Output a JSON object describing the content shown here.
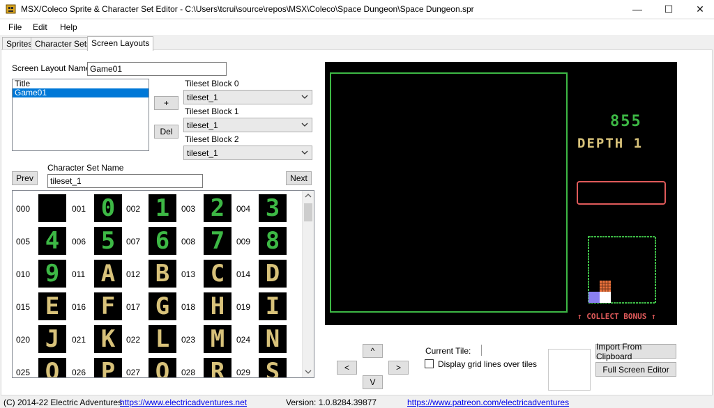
{
  "window": {
    "title": "MSX/Coleco Sprite & Character Set Editor - C:\\Users\\tcrui\\source\\repos\\MSX\\Coleco\\Space Dungeon\\Space Dungeon.spr",
    "minimize": "—",
    "maximize": "☐",
    "close": "✕"
  },
  "menu": {
    "file": "File",
    "edit": "Edit",
    "help": "Help"
  },
  "tabs": {
    "sprites": "Sprites",
    "character_sets": "Character Sets",
    "screen_layouts": "Screen Layouts"
  },
  "layout": {
    "name_label": "Screen Layout Name:",
    "name_value": "Game01",
    "layouts": [
      "Title",
      "Game01"
    ],
    "add_button": "+",
    "del_button": "Del",
    "tileset_blocks": [
      {
        "label": "Tileset Block 0",
        "value": "tileset_1"
      },
      {
        "label": "Tileset Block 1",
        "value": "tileset_1"
      },
      {
        "label": "Tileset Block 2",
        "value": "tileset_1"
      }
    ]
  },
  "charset": {
    "name_label": "Character Set Name",
    "name_value": "tileset_1",
    "prev_button": "Prev",
    "next_button": "Next",
    "tile_numbers": [
      "000",
      "001",
      "002",
      "003",
      "004",
      "005",
      "006",
      "007",
      "008",
      "009",
      "010",
      "011",
      "012",
      "013",
      "014",
      "015",
      "016",
      "017",
      "018",
      "019",
      "020",
      "021",
      "022",
      "023",
      "024",
      "025",
      "026",
      "027",
      "028",
      "029"
    ],
    "tile_glyphs": [
      "",
      "0",
      "1",
      "2",
      "3",
      "4",
      "5",
      "6",
      "7",
      "8",
      "9",
      "A",
      "B",
      "C",
      "D",
      "E",
      "F",
      "G",
      "H",
      "I",
      "J",
      "K",
      "L",
      "M",
      "N",
      "O",
      "P",
      "Q",
      "R",
      "S"
    ]
  },
  "screen": {
    "score": "855",
    "depth": "DEPTH 1",
    "collect_bonus": "↑ COLLECT BONUS ↑"
  },
  "nav": {
    "up": "^",
    "left": "<",
    "right": ">",
    "down": "V"
  },
  "tile_info": {
    "current_tile_label": "Current Tile:",
    "grid_lines_label": "Display grid lines over tiles",
    "grid_lines_checked": false
  },
  "actions": {
    "import_clipboard": "Import From Clipboard",
    "full_screen_editor": "Full Screen Editor"
  },
  "status": {
    "copyright": "(C) 2014-22 Electric Adventures",
    "website": "https://www.electricadventures.net",
    "version": "Version: 1.0.8284.39877",
    "patreon": "https://www.patreon.com/electricadventures"
  },
  "colors": {
    "tile_green": "#3db845",
    "tile_gold": "#d8c27a",
    "screen_border_green": "#3db845",
    "score_green": "#3db845",
    "depth_gold": "#d8c27a",
    "bonus_red": "#e05a5a",
    "selection_blue": "#0078d7"
  }
}
